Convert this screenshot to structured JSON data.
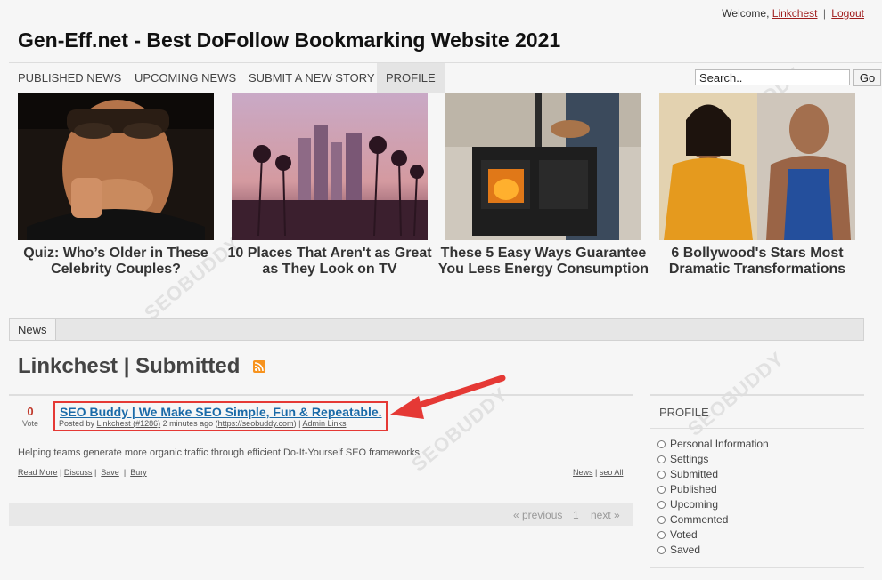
{
  "header": {
    "welcome_text": "Welcome,",
    "username": "Linkchest",
    "separator": "|",
    "logout": "Logout",
    "site_title": "Gen-Eff.net - Best DoFollow Bookmarking Website 2021"
  },
  "nav": {
    "items": [
      "Published News",
      "Upcoming News",
      "Submit a New Story",
      "Profile"
    ],
    "active": "Profile",
    "search_value": "Search..",
    "go_label": "Go"
  },
  "featured": [
    {
      "title": "Quiz: Who’s Older in These Celebrity Couples?",
      "image": "man-driving-car-photo"
    },
    {
      "title": "10 Places That Aren't as Great as They Look on TV",
      "image": "palm-trees-city-sunset-photo"
    },
    {
      "title": "These 5 Easy Ways Guarantee You Less Energy Consumption",
      "image": "wood-stove-kitchen-photo"
    },
    {
      "title": "6 Bollywood's Stars Most Dramatic Transformations",
      "image": "bollywood-actors-photo"
    }
  ],
  "tabs": {
    "news": "News"
  },
  "page": {
    "heading": "Linkchest | Submitted",
    "rss": "rss-icon"
  },
  "story": {
    "votes": "0",
    "vote_label": "Vote",
    "title": "SEO Buddy | We Make SEO Simple, Fun & Repeatable.",
    "meta_prefix": "Posted by",
    "author": "Linkchest (#1286)",
    "time": "2 minutes ago",
    "url_open": "(",
    "url": "https://seobuddy.com",
    "url_close": ")",
    "admin_sep": "|",
    "admin_links": "Admin Links",
    "description": "Helping teams generate more organic traffic through efficient Do-It-Yourself SEO frameworks.",
    "actions": {
      "read_more": "Read More",
      "discuss": "Discuss",
      "save": "Save",
      "bury": "Bury",
      "sep": "|"
    },
    "category": "News",
    "seo_all": "seo All"
  },
  "pager": {
    "previous": "« previous",
    "page": "1",
    "next": "next »"
  },
  "sidebar": {
    "heading": "Profile",
    "items": [
      "Personal Information",
      "Settings",
      "Submitted",
      "Published",
      "Upcoming",
      "Commented",
      "Voted",
      "Saved"
    ]
  },
  "watermark": "SEOBUDDY",
  "colors": {
    "highlight": "#e53935",
    "story_link": "#1a6aa8",
    "vote": "#c0392b",
    "user_link": "#a01d1d"
  }
}
